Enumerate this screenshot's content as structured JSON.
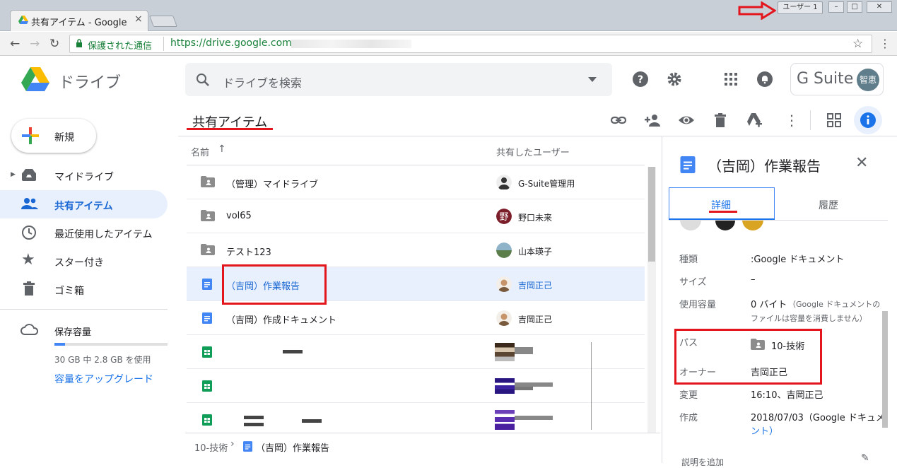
{
  "browser": {
    "tab_title": "共有アイテム - Google",
    "user_chip": "ユーザー 1",
    "secure_label": "保護された通信",
    "url": "https://drive.google.com"
  },
  "header": {
    "logo_text": "ドライブ",
    "search_placeholder": "ドライブを検索",
    "gsuite_label": "G Suite",
    "avatar_text": "智恵"
  },
  "sidebar": {
    "new_label": "新規",
    "items": [
      {
        "label": "マイドライブ"
      },
      {
        "label": "共有アイテム"
      },
      {
        "label": "最近使用したアイテム"
      },
      {
        "label": "スター付き"
      },
      {
        "label": "ゴミ箱"
      }
    ],
    "storage_title": "保存容量",
    "storage_used": "30 GB 中 2.8 GB を使用",
    "upgrade_label": "容量をアップグレード"
  },
  "main": {
    "title": "共有アイテム",
    "col_name": "名前",
    "col_shared": "共有したユーザー",
    "rows": [
      {
        "name": "（管理）マイドライブ",
        "user": "G-Suite管理用"
      },
      {
        "name": "vol65",
        "user": "野口未来"
      },
      {
        "name": "テスト123",
        "user": "山本瑛子"
      },
      {
        "name": "（吉岡）作業報告",
        "user": "吉岡正己"
      },
      {
        "name": "（吉岡）作成ドキュメント",
        "user": "吉岡正己"
      }
    ],
    "breadcrumb_folder": "10-技術",
    "breadcrumb_file": "（吉岡）作業報告"
  },
  "details": {
    "title": "（吉岡）作業報告",
    "tab_detail": "詳細",
    "tab_history": "履歴",
    "type_key": "種類",
    "type_val": ":Google ドキュメント",
    "size_key": "サイズ",
    "size_val": "–",
    "usage_key": "使用容量",
    "usage_val": "0 バイト",
    "usage_note1": "（Google ドキュメントの",
    "usage_note2": "ファイルは容量を消費しません）",
    "path_key": "パス",
    "path_val": "10-技術",
    "owner_key": "オーナー",
    "owner_val": "吉岡正己",
    "modified_key": "変更",
    "modified_val": "16:10、吉岡正己",
    "created_key": "作成",
    "created_val1": "2018/07/03（Google ドキュメ",
    "created_val2": "ント）",
    "add_desc": "説明を追加"
  },
  "colors": {
    "accent": "#1a73e8",
    "annotation_red": "#e3161e",
    "selected_row": "#e8f0fe"
  }
}
